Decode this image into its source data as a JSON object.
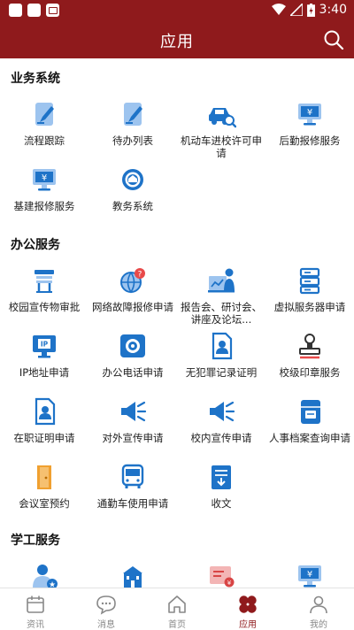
{
  "status_bar": {
    "time": "3:40"
  },
  "header": {
    "title": "应用"
  },
  "sections": [
    {
      "title": "业务系统",
      "items": [
        {
          "label": "流程跟踪",
          "icon": "pen-document-icon"
        },
        {
          "label": "待办列表",
          "icon": "pen-document-icon"
        },
        {
          "label": "机动车进校许可申请",
          "icon": "car-search-icon"
        },
        {
          "label": "后勤报修服务",
          "icon": "monitor-yen-icon"
        },
        {
          "label": "基建报修服务",
          "icon": "monitor-yen-icon"
        },
        {
          "label": "教务系统",
          "icon": "emblem-icon"
        }
      ]
    },
    {
      "title": "办公服务",
      "items": [
        {
          "label": "校园宣传物审批",
          "icon": "billboard-icon"
        },
        {
          "label": "网络故障报修申请",
          "icon": "globe-alert-icon"
        },
        {
          "label": "报告会、研讨会、讲座及论坛...",
          "icon": "presenter-icon"
        },
        {
          "label": "虚拟服务器申请",
          "icon": "server-icon"
        },
        {
          "label": "IP地址申请",
          "icon": "ip-monitor-icon"
        },
        {
          "label": "办公电话申请",
          "icon": "telephone-icon"
        },
        {
          "label": "无犯罪记录证明",
          "icon": "person-document-icon"
        },
        {
          "label": "校级印章服务",
          "icon": "stamp-icon"
        },
        {
          "label": "在职证明申请",
          "icon": "person-document-icon"
        },
        {
          "label": "对外宣传申请",
          "icon": "megaphone-icon"
        },
        {
          "label": "校内宣传申请",
          "icon": "megaphone-icon"
        },
        {
          "label": "人事档案查询申请",
          "icon": "archive-folder-icon"
        },
        {
          "label": "会议室预约",
          "icon": "door-icon"
        },
        {
          "label": "通勤车使用申请",
          "icon": "bus-icon"
        },
        {
          "label": "收文",
          "icon": "inbox-document-icon"
        }
      ]
    },
    {
      "title": "学工服务",
      "items": [
        {
          "label": "",
          "icon": "person-star-icon"
        },
        {
          "label": "",
          "icon": "school-building-icon"
        },
        {
          "label": "",
          "icon": "certificate-icon"
        },
        {
          "label": "",
          "icon": "monitor-yen-icon"
        }
      ]
    }
  ],
  "tabs": [
    {
      "label": "资讯",
      "icon": "calendar-icon",
      "active": false
    },
    {
      "label": "消息",
      "icon": "chat-bubble-icon",
      "active": false
    },
    {
      "label": "首页",
      "icon": "home-icon",
      "active": false
    },
    {
      "label": "应用",
      "icon": "apps-icon",
      "active": true
    },
    {
      "label": "我的",
      "icon": "person-icon",
      "active": false
    }
  ],
  "colors": {
    "brand": "#8f1a1c",
    "icon_blue": "#1e73c8",
    "icon_light": "#9dc4ef",
    "icon_orange": "#f0a030"
  }
}
